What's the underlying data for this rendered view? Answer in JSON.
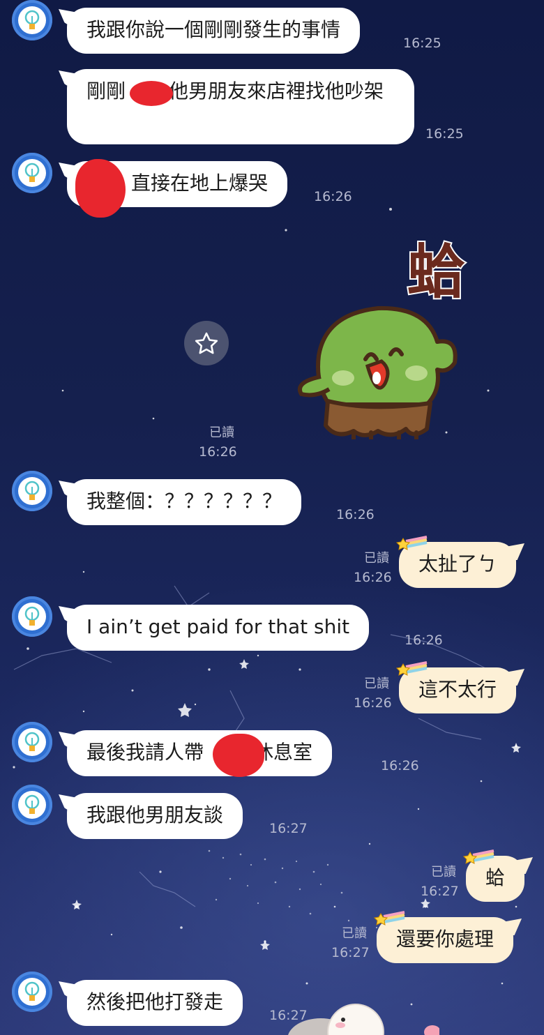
{
  "messages": [
    {
      "side": "left",
      "text": "我跟你說一個剛剛發生的事情",
      "time": "16:25"
    },
    {
      "side": "left",
      "text": "剛剛",
      "text_after": "他男朋友來店裡找他吵架",
      "time": "16:25"
    },
    {
      "side": "left",
      "text": "直接在地上爆哭",
      "time": "16:26"
    },
    {
      "side": "right",
      "type": "sticker",
      "sticker_text": "蛤",
      "read": "已讀",
      "time": "16:26"
    },
    {
      "side": "left",
      "text": "我整個：？？？？？？",
      "time": "16:26"
    },
    {
      "side": "right",
      "text": "太扯了ㄅ",
      "read": "已讀",
      "time": "16:26"
    },
    {
      "side": "left",
      "text": "I ain’t get paid for that shit",
      "time": "16:26"
    },
    {
      "side": "right",
      "text": "這不太行",
      "read": "已讀",
      "time": "16:26"
    },
    {
      "side": "left",
      "text": "最後我請人帶",
      "text_after": "回休息室",
      "time": "16:26"
    },
    {
      "side": "left",
      "text": "我跟他男朋友談",
      "time": "16:27"
    },
    {
      "side": "right",
      "text": "蛤",
      "read": "已讀",
      "time": "16:27"
    },
    {
      "side": "right",
      "text": "還要你處理",
      "read": "已讀",
      "time": "16:27"
    },
    {
      "side": "left",
      "text": "然後把他打發走",
      "time": "16:27"
    }
  ],
  "colors": {
    "background": "#15204e",
    "left_bubble": "#ffffff",
    "right_bubble": "#fdf0d6",
    "avatar": "#2f6fd1",
    "redaction": "#e8262e",
    "sticker_green": "#7db64a"
  },
  "icons": {
    "favorite": "star-icon",
    "avatar": "lightbulb-icon"
  }
}
